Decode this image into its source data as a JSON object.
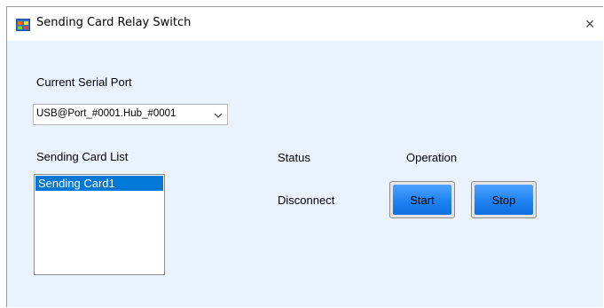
{
  "window": {
    "title": "Sending Card Relay Switch",
    "close_glyph": "×",
    "icon": "app-window-icon"
  },
  "serial_port": {
    "label": "Current Serial Port",
    "selected_value": "USB@Port_#0001.Hub_#0001"
  },
  "card_list": {
    "label": "Sending Card List",
    "items": [
      "Sending Card1"
    ],
    "selected_index": 0
  },
  "status": {
    "header": "Status",
    "value": "Disconnect"
  },
  "operation": {
    "header": "Operation",
    "start_label": "Start",
    "stop_label": "Stop"
  },
  "colors": {
    "button_blue": "#1f82f2",
    "selection": "#0078d7",
    "window_bg": "#eaf3fd"
  }
}
